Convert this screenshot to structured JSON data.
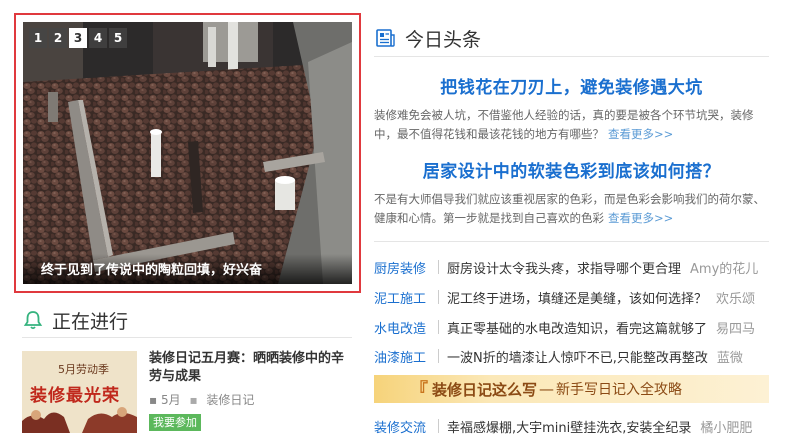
{
  "slider": {
    "numbers": [
      "1",
      "2",
      "3",
      "4",
      "5"
    ],
    "active_index": 3,
    "caption": "终于见到了传说中的陶粒回填，好兴奋"
  },
  "progress": {
    "title": "正在进行",
    "poster": {
      "sub": "5月劳动季",
      "main": "装修最光荣"
    },
    "item_title": "装修日记五月赛：晒晒装修中的辛劳与成果",
    "month": "5月",
    "category": "装修日记",
    "join_label": "我要参加"
  },
  "headlines": {
    "title": "今日头条",
    "articles": [
      {
        "title": "把钱花在刀刃上，避免装修遇大坑",
        "desc": "装修难免会被人坑，不借鉴他人经验的话，真的要是被各个环节坑哭，装修中，最不值得花钱和最该花钱的地方有哪些？",
        "more": "查看更多>>"
      },
      {
        "title": "居家设计中的软装色彩到底该如何搭？",
        "desc": "不是有大师倡导我们就应该重视居家的色彩，而是色彩会影响我们的荷尔蒙、健康和心情。第一步就是找到自己喜欢的色彩",
        "more": "查看更多>>"
      }
    ]
  },
  "categories": [
    {
      "name": "厨房装修",
      "text": "厨房设计太令我头疼，求指导哪个更合理",
      "author": "Amy的花儿"
    },
    {
      "name": "泥工施工",
      "text": "泥工终于进场，填缝还是美缝，该如何选择？",
      "author": "欢乐颂"
    },
    {
      "name": "水电改造",
      "text": "真正零基础的水电改造知识，看完这篇就够了",
      "author": "易四马"
    },
    {
      "name": "油漆施工",
      "text": "一波N折的墙漆让人惊吓不已,只能整改再整改",
      "author": "蓝微"
    },
    {
      "name": "装修交流",
      "text": "幸福感爆棚,大宇mini壁挂洗衣,安装全纪录",
      "author": "橘小肥肥"
    }
  ],
  "banner": {
    "main": "装修日记这么写",
    "sub": "新手写日记入全攻略"
  },
  "colors": {
    "accent_blue": "#1a6fcf",
    "slider_border": "#e0393e",
    "join_green": "#5cb85c"
  }
}
